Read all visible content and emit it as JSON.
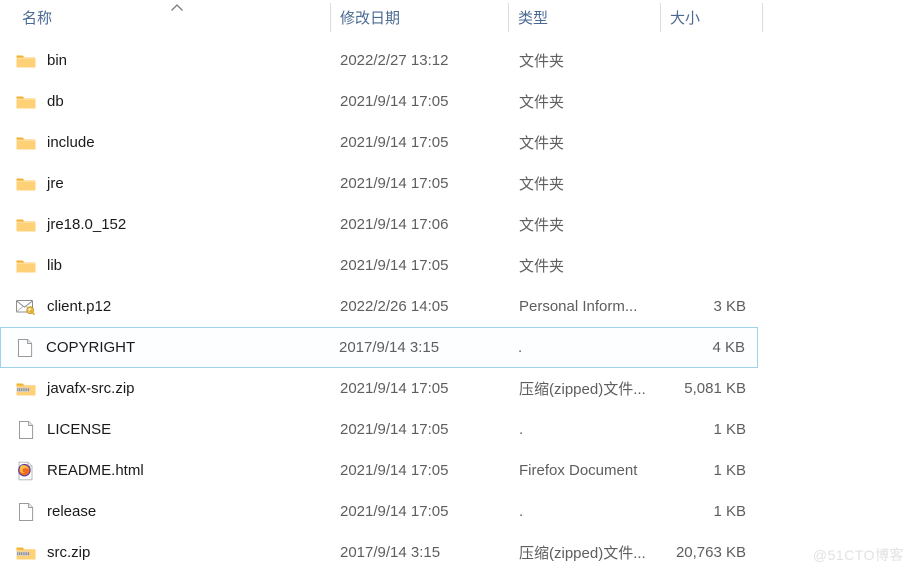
{
  "header": {
    "sort_indicator": "sort-ascending-arrow",
    "columns": [
      {
        "key": "name",
        "label": "名称"
      },
      {
        "key": "date",
        "label": "修改日期"
      },
      {
        "key": "type",
        "label": "类型"
      },
      {
        "key": "size",
        "label": "大小"
      }
    ]
  },
  "rows": [
    {
      "icon": "folder-icon",
      "name": "bin",
      "date": "2022/2/27 13:12",
      "type": "文件夹",
      "size": "",
      "selected": false
    },
    {
      "icon": "folder-icon",
      "name": "db",
      "date": "2021/9/14 17:05",
      "type": "文件夹",
      "size": "",
      "selected": false
    },
    {
      "icon": "folder-icon",
      "name": "include",
      "date": "2021/9/14 17:05",
      "type": "文件夹",
      "size": "",
      "selected": false
    },
    {
      "icon": "folder-icon",
      "name": "jre",
      "date": "2021/9/14 17:05",
      "type": "文件夹",
      "size": "",
      "selected": false
    },
    {
      "icon": "folder-icon",
      "name": "jre18.0_152",
      "date": "2021/9/14 17:06",
      "type": "文件夹",
      "size": "",
      "selected": false
    },
    {
      "icon": "folder-icon",
      "name": "lib",
      "date": "2021/9/14 17:05",
      "type": "文件夹",
      "size": "",
      "selected": false
    },
    {
      "icon": "certificate-icon",
      "name": "client.p12",
      "date": "2022/2/26 14:05",
      "type": "Personal Inform...",
      "size": "3 KB",
      "selected": false
    },
    {
      "icon": "blank-document-icon",
      "name": "COPYRIGHT",
      "date": "2017/9/14 3:15",
      "type": ".",
      "size": "4 KB",
      "selected": true
    },
    {
      "icon": "zipped-folder-icon",
      "name": "javafx-src.zip",
      "date": "2021/9/14 17:05",
      "type": "压缩(zipped)文件...",
      "size": "5,081 KB",
      "selected": false
    },
    {
      "icon": "blank-document-icon",
      "name": "LICENSE",
      "date": "2021/9/14 17:05",
      "type": ".",
      "size": "1 KB",
      "selected": false
    },
    {
      "icon": "firefox-icon",
      "name": "README.html",
      "date": "2021/9/14 17:05",
      "type": "Firefox Document",
      "size": "1 KB",
      "selected": false
    },
    {
      "icon": "blank-document-icon",
      "name": "release",
      "date": "2021/9/14 17:05",
      "type": ".",
      "size": "1 KB",
      "selected": false
    },
    {
      "icon": "zipped-folder-icon",
      "name": "src.zip",
      "date": "2017/9/14 3:15",
      "type": "压缩(zipped)文件...",
      "size": "20,763 KB",
      "selected": false
    }
  ],
  "watermark": {
    "text": "@51CTO博客"
  },
  "colors": {
    "header_text": "#4a6a93",
    "row_text": "#1b1b1b",
    "secondary_text": "#5e5e5e",
    "selection_border": "#9ed2ec",
    "selection_fill": "#fcfeff",
    "separator": "#dcdcdc",
    "folder_yellow": "#ffd177",
    "folder_tab": "#f2b233",
    "watermark": "#e2e2e2"
  }
}
